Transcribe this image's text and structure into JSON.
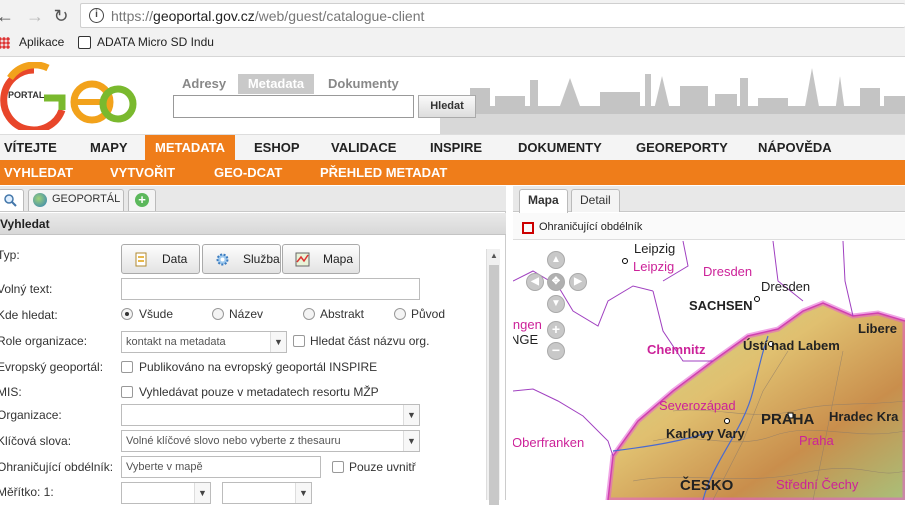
{
  "browser": {
    "url_domain": "geoportal.gov.cz",
    "url_path": "/web/guest/catalogue-client",
    "url_prefix": "https://",
    "bookmarks": [
      "Aplikace",
      "ADATA Micro SD Indu"
    ]
  },
  "header": {
    "logo_text": "PORTAL",
    "search_tabs": [
      "Adresy",
      "Metadata",
      "Dokumenty"
    ],
    "search_button": "Hledat"
  },
  "main_menu": [
    "VÍTEJTE",
    "MAPY",
    "METADATA",
    "ESHOP",
    "VALIDACE",
    "INSPIRE",
    "DOKUMENTY",
    "GEOREPORTY",
    "NÁPOVĚDA"
  ],
  "sub_menu": [
    "VYHLEDAT",
    "VYTVOŘIT",
    "GEO-DCAT",
    "PŘEHLED METADAT"
  ],
  "left_panel": {
    "tab_geoportal": "GEOPORTÁL",
    "title": "Vyhledat",
    "labels": {
      "typ": "Typ:",
      "volny_text": "Volný text:",
      "kde_hledat": "Kde hledat:",
      "role": "Role organizace:",
      "evropsky": "Evropský geoportál:",
      "mis": "MIS:",
      "organizace": "Organizace:",
      "klicova": "Klíčová slova:",
      "ohranicujici": "Ohraničující obdélník:",
      "meritko": "Měřítko: 1:"
    },
    "type_buttons": [
      "Data",
      "Služba",
      "Mapa"
    ],
    "where_options": [
      "Všude",
      "Název",
      "Abstrakt",
      "Původ"
    ],
    "role_select": "kontakt na metadata",
    "role_checkbox": "Hledat část názvu org.",
    "evropsky_checkbox": "Publikováno na evropský geoportál INSPIRE",
    "mis_checkbox": "Vyhledávat pouze v metadatech resortu MŽP",
    "keywords_placeholder": "Volné klíčové slovo nebo vyberte z thesauru",
    "bbox_placeholder": "Vyberte v mapě",
    "bbox_checkbox": "Pouze uvnitř"
  },
  "right_panel": {
    "tabs": [
      "Mapa",
      "Detail"
    ],
    "toolbar_label": "Ohraničující obdélník",
    "map_labels": {
      "leipzig_black": "Leipzig",
      "leipzig_pink": "Leipzig",
      "dresden_pink": "Dresden",
      "dresden_black": "Dresden",
      "sachsen": "SACHSEN",
      "chemnitz": "Chemnitz",
      "usti": "Ústí nad Labem",
      "liberec": "Libere",
      "severozapad": "Severozápad",
      "praha_black": "PRAHA",
      "hradec": "Hradec Kra",
      "karlovy": "Karlovy Vary",
      "praha_pink": "Praha",
      "oberfranken": "Oberfranken",
      "ingen": "ingen",
      "nge": "NGE",
      "cesko": "ČESKO",
      "stredni": "Střední Čechy"
    }
  },
  "colors": {
    "menu_orange": "#ef7d1a",
    "map_pink": "#cc2299"
  }
}
